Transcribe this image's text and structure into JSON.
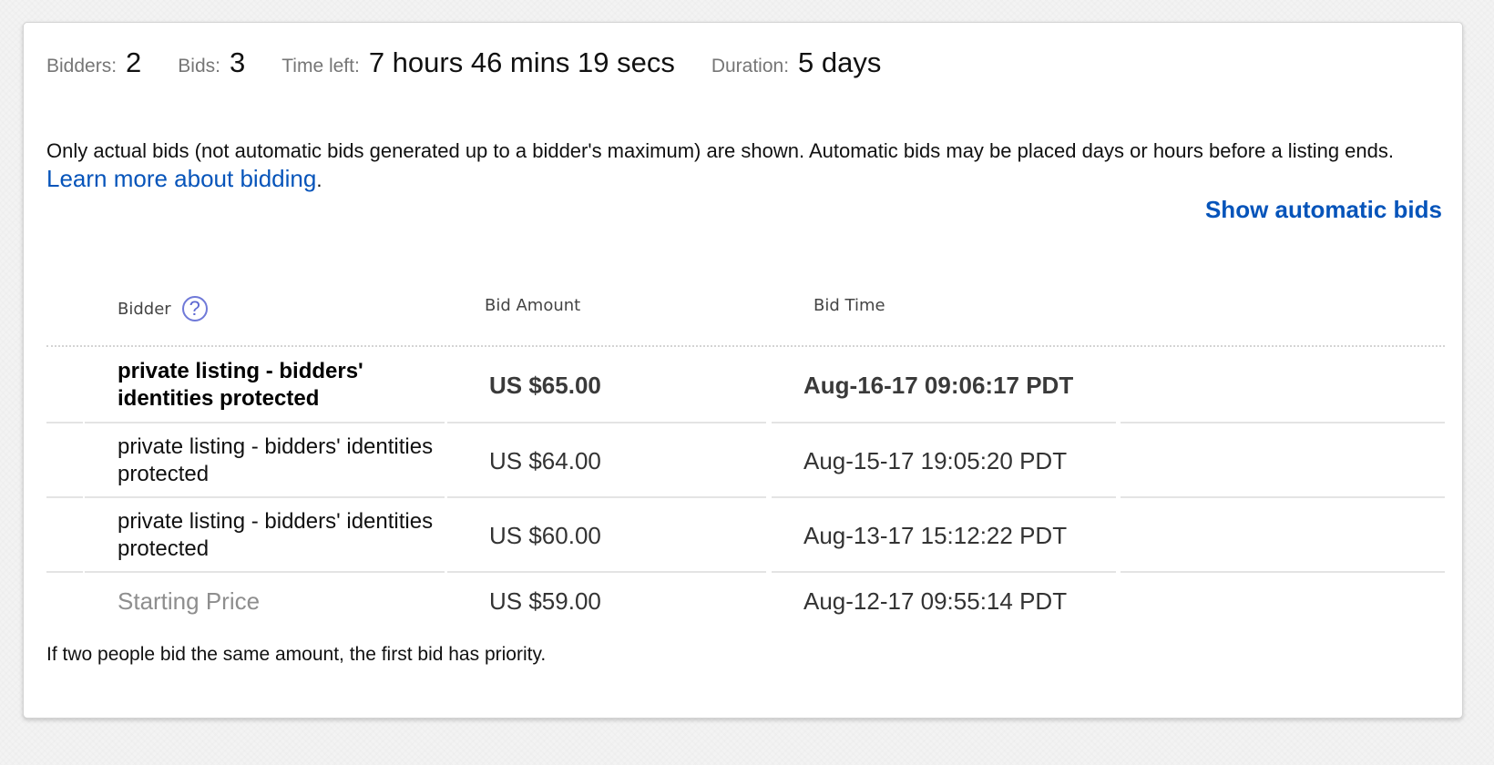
{
  "summary": {
    "bidders_label": "Bidders:",
    "bidders_value": "2",
    "bids_label": "Bids:",
    "bids_value": "3",
    "time_left_label": "Time left:",
    "time_left_value": "7 hours 46 mins 19 secs",
    "duration_label": "Duration:",
    "duration_value": "5 days"
  },
  "notice": {
    "text": "Only actual bids (not automatic bids generated up to a bidder's maximum) are shown. Automatic bids may be placed days or hours before a listing ends.",
    "link_text": "Learn more about bidding",
    "period": "."
  },
  "actions": {
    "show_automatic_bids": "Show automatic bids"
  },
  "table": {
    "headers": {
      "bidder": "Bidder",
      "bid_amount": "Bid Amount",
      "bid_time": "Bid Time"
    },
    "help_icon_glyph": "?",
    "rows": [
      {
        "bidder": "private listing - bidders' identities protected",
        "amount": "US $65.00",
        "time": "Aug-16-17 09:06:17 PDT"
      },
      {
        "bidder": "private listing - bidders' identities protected",
        "amount": "US $64.00",
        "time": "Aug-15-17 19:05:20 PDT"
      },
      {
        "bidder": "private listing - bidders' identities protected",
        "amount": "US $60.00",
        "time": "Aug-13-17 15:12:22 PDT"
      },
      {
        "bidder": "Starting Price",
        "amount": "US $59.00",
        "time": "Aug-12-17 09:55:14 PDT"
      }
    ]
  },
  "footer": {
    "note": "If two people bid the same amount, the first bid has priority."
  },
  "colors": {
    "link": "#0654ba",
    "help_icon": "#6f79d8",
    "muted_text": "#767676",
    "starting_price_text": "#8e8e8e"
  },
  "icons": {
    "help": "question-circle-icon"
  }
}
